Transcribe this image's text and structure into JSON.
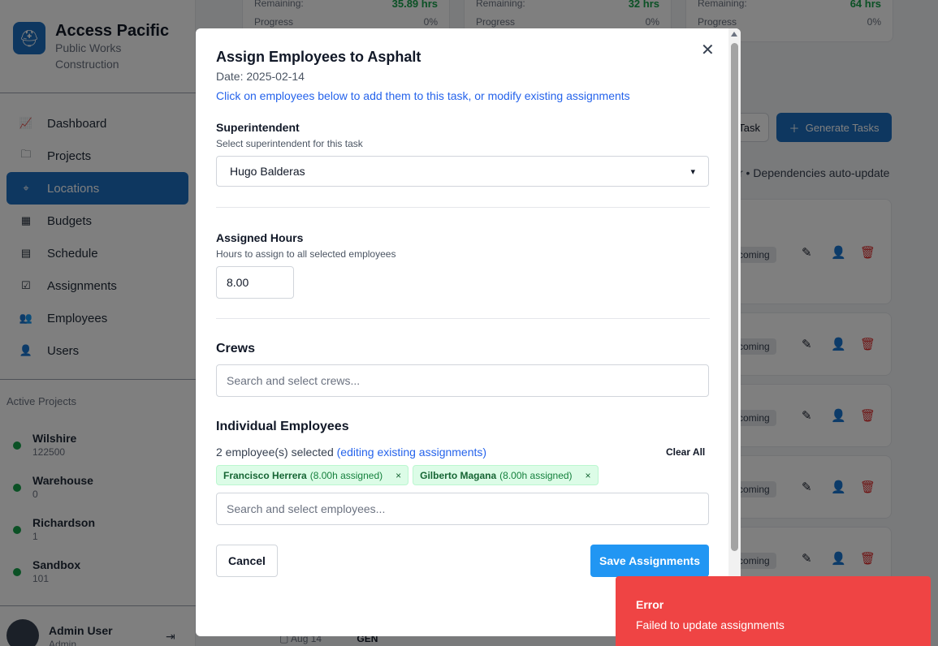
{
  "brand": {
    "name": "Access Pacific",
    "subtitle_line1": "Public Works",
    "subtitle_line2": "Construction"
  },
  "nav": [
    {
      "label": "Dashboard",
      "icon": "chart-line-icon"
    },
    {
      "label": "Projects",
      "icon": "folder-icon"
    },
    {
      "label": "Locations",
      "icon": "map-pin-icon",
      "active": true
    },
    {
      "label": "Budgets",
      "icon": "calculator-icon"
    },
    {
      "label": "Schedule",
      "icon": "calendar-icon"
    },
    {
      "label": "Assignments",
      "icon": "checkbox-icon"
    },
    {
      "label": "Employees",
      "icon": "users-icon"
    },
    {
      "label": "Users",
      "icon": "user-icon"
    }
  ],
  "active_projects": {
    "title": "Active Projects",
    "items": [
      {
        "name": "Wilshire",
        "number": "122500"
      },
      {
        "name": "Warehouse",
        "number": "0"
      },
      {
        "name": "Richardson",
        "number": "1"
      },
      {
        "name": "Sandbox",
        "number": "101"
      }
    ]
  },
  "user": {
    "name": "Admin User",
    "role": "Admin"
  },
  "background": {
    "stat_cards": [
      {
        "remaining_label": "Remaining:",
        "remaining_value": "35.89 hrs",
        "progress_label": "Progress",
        "progress_value": "0%"
      },
      {
        "remaining_label": "Remaining:",
        "remaining_value": "32 hrs",
        "progress_label": "Progress",
        "progress_value": "0%"
      },
      {
        "remaining_label": "Remaining:",
        "remaining_value": "64 hrs",
        "progress_label": "Progress",
        "progress_value": "0%"
      }
    ],
    "task_btn": "Task",
    "generate_btn": "Generate Tasks",
    "deps_text": "r • Dependencies auto-update",
    "status_label": "coming",
    "footer_date": "Aug 14",
    "footer_code": "GEN"
  },
  "modal": {
    "title": "Assign Employees to Asphalt",
    "date": "Date: 2025-02-14",
    "hint": "Click on employees below to add them to this task, or modify existing assignments",
    "superintendent": {
      "label": "Superintendent",
      "sublabel": "Select superintendent for this task",
      "value": "Hugo Balderas"
    },
    "hours": {
      "label": "Assigned Hours",
      "sublabel": "Hours to assign to all selected employees",
      "value": "8.00"
    },
    "crews": {
      "label": "Crews",
      "placeholder": "Search and select crews..."
    },
    "employees": {
      "label": "Individual Employees",
      "selected_count": "2 employee(s) selected",
      "editing_note": "(editing existing assignments)",
      "clear_all": "Clear All",
      "selected": [
        {
          "name": "Francisco Herrera",
          "hours": "(8.00h assigned)"
        },
        {
          "name": "Gilberto Magana",
          "hours": "(8.00h assigned)"
        }
      ],
      "placeholder": "Search and select employees..."
    },
    "cancel_label": "Cancel",
    "save_label": "Save Assignments"
  },
  "toast": {
    "title": "Error",
    "message": "Failed to update assignments"
  },
  "colors": {
    "primary": "#1d6fc1",
    "save": "#2196f3",
    "error": "#ef4444",
    "chip_bg": "#dcfce7"
  }
}
